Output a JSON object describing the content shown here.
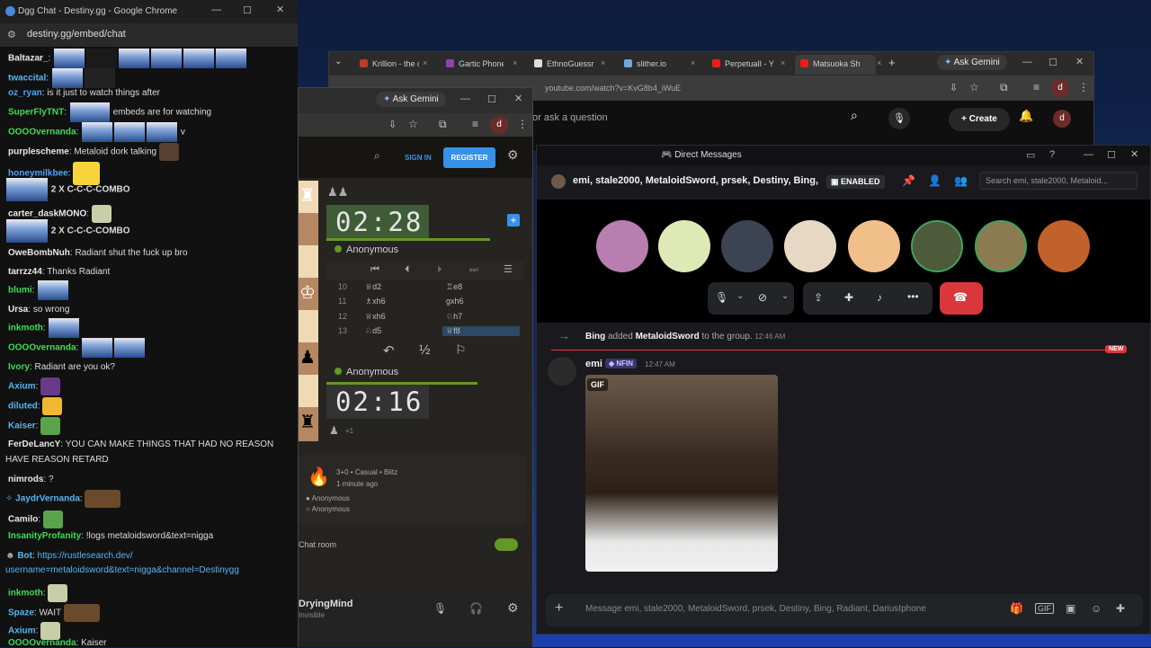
{
  "chat_window": {
    "title": "Dgg Chat - Destiny.gg - Google Chrome",
    "url": "destiny.gg/embed/chat",
    "messages": [
      {
        "user": "Baltazar_",
        "text": "",
        "emotes": 5
      },
      {
        "user": "twaccital",
        "text": "",
        "emotes": 2
      },
      {
        "user": "oz_ryan",
        "text": "is it just to watch things after"
      },
      {
        "user": "SuperFlyTNT",
        "text": "embeds are for watching"
      },
      {
        "user": "OOOOvernanda",
        "text": "v"
      },
      {
        "user": "purplescheme",
        "text": "Metaloid dork talking"
      },
      {
        "user": "honeymilkbee",
        "text": ""
      },
      {
        "user": "",
        "text": "2 X C-C-C-COMBO"
      },
      {
        "user": "carter_daskMONO",
        "text": ""
      },
      {
        "user": "",
        "text": "2 X C-C-C-COMBO"
      },
      {
        "user": "OweBombNuh",
        "text": "Radiant shut the fuck up bro"
      },
      {
        "user": "tarrzz44",
        "text": "Thanks Radiant"
      },
      {
        "user": "blumi",
        "text": ""
      },
      {
        "user": "Ursa",
        "text": "so wrong"
      },
      {
        "user": "inkmoth",
        "text": ""
      },
      {
        "user": "OOOOvernanda",
        "text": ""
      },
      {
        "user": "Ivory",
        "text": "Radiant are you ok?"
      },
      {
        "user": "Axium",
        "text": ""
      },
      {
        "user": "diluted",
        "text": ""
      },
      {
        "user": "Kaiser",
        "text": ""
      },
      {
        "user": "FerDeLancY",
        "text": "YOU CAN MAKE THINGS THAT HAD NO REASON"
      },
      {
        "user": "",
        "text": "HAVE REASON RETARD"
      },
      {
        "user": "nimrods",
        "text": "?"
      },
      {
        "user": "JaydrVernanda",
        "text": ""
      },
      {
        "user": "Camilo",
        "text": ""
      },
      {
        "user": "InsanityProfanity",
        "text": "!logs metaloidsword&text=nigga"
      },
      {
        "user": "Bot",
        "text": "https://rustlesearch.dev/"
      },
      {
        "user": "",
        "text": "username=metaloidsword&text=nigga&channel=Destinygg"
      },
      {
        "user": "inkmoth",
        "text": ""
      },
      {
        "user": "Spaze",
        "text": "WAIT"
      },
      {
        "user": "Axium",
        "text": ""
      },
      {
        "user": "OOOOvernanda",
        "text": "Kaiser"
      }
    ]
  },
  "yt_window": {
    "tabs": [
      "Krillion - the d",
      "Gartic Phone",
      "EthnoGuessr",
      "slither.io",
      "PerpetualI - Y",
      "Matsuoka Sh"
    ],
    "gemini": "Ask Gemini",
    "url": "youtube.com/watch?v=KvG8b4_iWuE",
    "search_placeholder": "or ask a question",
    "create_label": "Create",
    "avatar_letter": "d"
  },
  "lichess_window": {
    "gemini": "Ask Gemini",
    "sign_in": "SIGN IN",
    "register": "REGISTER",
    "clock_top": "02:28",
    "clock_bottom": "02:16",
    "player_top": "Anonymous",
    "player_bottom": "Anonymous",
    "moves": [
      {
        "n": "10",
        "w": "♕d2",
        "b": "♖e8"
      },
      {
        "n": "11",
        "w": "♗xh6",
        "b": "gxh6"
      },
      {
        "n": "12",
        "w": "♕xh6",
        "b": "♘h7"
      },
      {
        "n": "13",
        "w": "♘d5",
        "b": "♕f8"
      }
    ],
    "plus_one": "+1",
    "game_type": "3+0 • Casual • Blitz",
    "game_time": "1 minute ago",
    "players": [
      "Anonymous",
      "Anonymous"
    ],
    "chat_room": "Chat room",
    "user_name": "DryingMind",
    "user_status": "Invisible",
    "half": "½"
  },
  "discord": {
    "title": "Direct Messages",
    "group_name": "emi, stale2000, MetaloidSword, prsek, Destiny, Bing,",
    "enabled_badge": "ENABLED",
    "search_placeholder": "Search emi, stale2000, Metaloid...",
    "system_msg": {
      "actor": "Bing",
      "verb": "added",
      "target": "MetaloidSword",
      "rest": "to the group.",
      "time": "12:46 AM"
    },
    "new_label": "NEW",
    "message": {
      "author": "emi",
      "tag": "NFIN",
      "time": "12:47 AM",
      "gif_label": "GIF"
    },
    "input_placeholder": "Message emi, stale2000, MetaloidSword, prsek, Destiny, Bing, Radiant, DariusIphone",
    "colors": {
      "hangup": "#da373c",
      "accent": "#5865f2"
    }
  }
}
